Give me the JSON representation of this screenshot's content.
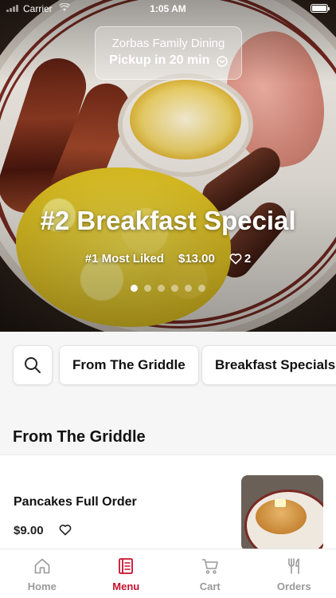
{
  "status_bar": {
    "carrier": "Carrier",
    "time": "1:05 AM"
  },
  "pickup": {
    "restaurant": "Zorbas Family Dining",
    "time_label": "Pickup in 20 min"
  },
  "hero": {
    "title": "#2 Breakfast Special",
    "rank": "#1 Most Liked",
    "price": "$13.00",
    "likes": "2",
    "carousel": {
      "count": 6,
      "active_index": 0
    }
  },
  "categories": [
    "From The Griddle",
    "Breakfast Specials"
  ],
  "section": {
    "title": "From The Griddle"
  },
  "items": [
    {
      "name": "Pancakes Full Order",
      "price": "$9.00"
    }
  ],
  "tabs": [
    {
      "label": "Home",
      "icon": "home-icon",
      "active": false
    },
    {
      "label": "Menu",
      "icon": "menu-icon",
      "active": true
    },
    {
      "label": "Cart",
      "icon": "cart-icon",
      "active": false
    },
    {
      "label": "Orders",
      "icon": "utensils-icon",
      "active": false
    }
  ],
  "colors": {
    "accent": "#c8102e",
    "inactive": "#9a9a9a"
  }
}
